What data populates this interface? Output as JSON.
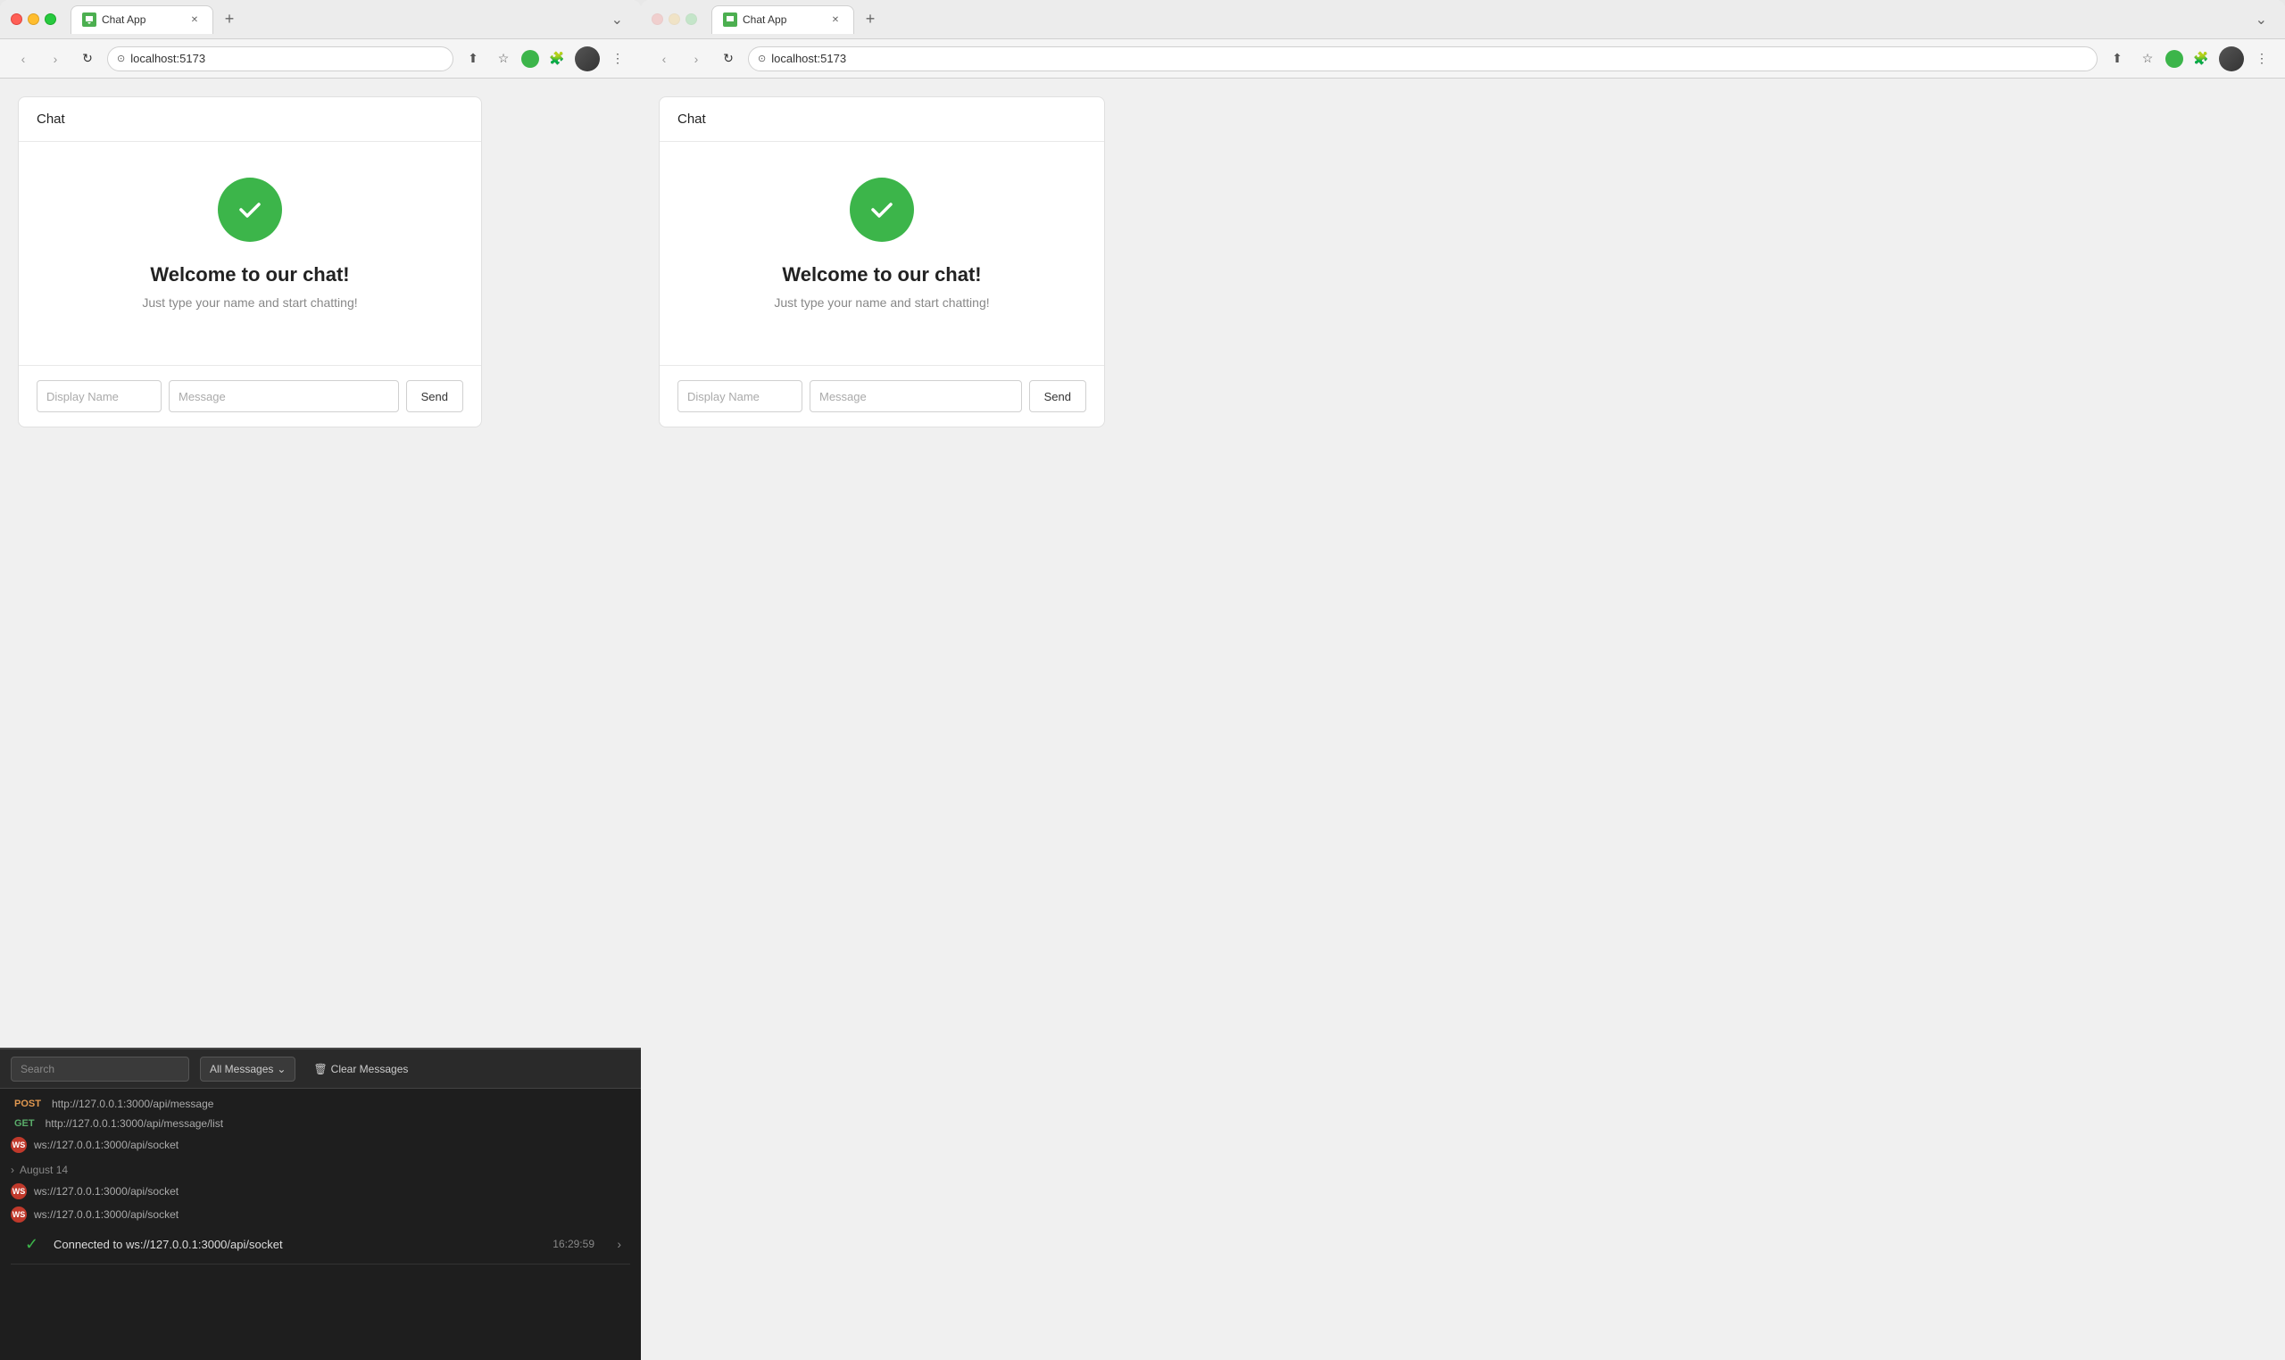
{
  "left_browser": {
    "traffic": [
      "close",
      "minimize",
      "maximize"
    ],
    "tab": {
      "title": "Chat App",
      "favicon": "chat"
    },
    "new_tab_label": "+",
    "tab_overflow_label": "›",
    "toolbar": {
      "back": "‹",
      "forward": "›",
      "reload": "↻",
      "url": "localhost:5173",
      "menu": "⋮"
    },
    "chat": {
      "header": "Chat",
      "welcome_title": "Welcome to our chat!",
      "welcome_subtitle": "Just type your name and start chatting!",
      "display_name_placeholder": "Display Name",
      "message_placeholder": "Message",
      "send_label": "Send"
    }
  },
  "right_browser": {
    "tab": {
      "title": "Chat App",
      "favicon": "chat"
    },
    "new_tab_label": "+",
    "tab_overflow_label": "›",
    "toolbar": {
      "url": "localhost:5173",
      "menu": "⋮"
    },
    "chat": {
      "header": "Chat",
      "welcome_title": "Welcome to our chat!",
      "welcome_subtitle": "Just type your name and start chatting!",
      "display_name_placeholder": "Display Name",
      "message_placeholder": "Message",
      "send_label": "Send"
    }
  },
  "devtools": {
    "search_placeholder": "Search",
    "filter_label": "All Messages",
    "clear_label": "Clear Messages",
    "network_items": [
      {
        "method": "POST",
        "type": "http",
        "url": "http://127.0.0.1:3000/api/message"
      },
      {
        "method": "GET",
        "type": "http",
        "url": "http://127.0.0.1:3000/api/message/list"
      },
      {
        "method": "WS",
        "type": "ws",
        "url": "ws://127.0.0.1:3000/api/socket"
      }
    ],
    "date_section": "August 14",
    "ws_items": [
      {
        "method": "WS",
        "type": "ws",
        "url": "ws://127.0.0.1:3000/api/socket"
      },
      {
        "method": "WS",
        "type": "ws",
        "url": "ws://127.0.0.1:3000/api/socket"
      }
    ],
    "connected_message": "Connected to ws://127.0.0.1:3000/api/socket",
    "connected_time": "16:29:59"
  }
}
